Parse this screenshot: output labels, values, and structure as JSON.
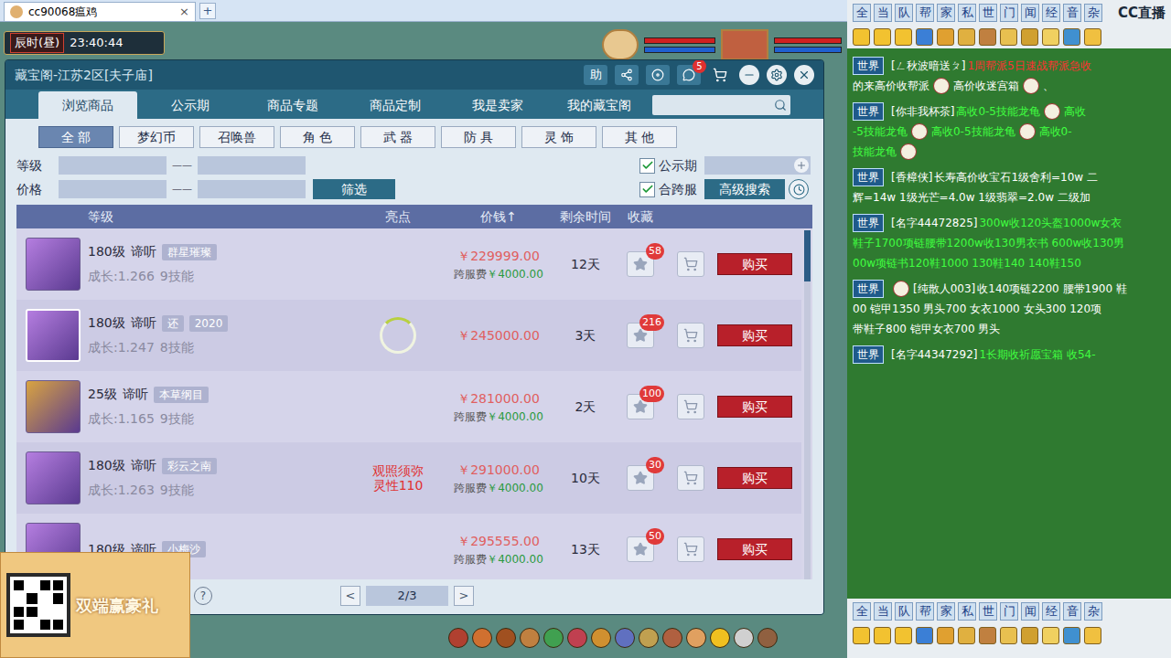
{
  "browser_tab": {
    "title": "cc90068瘟鸡",
    "close": "×",
    "new_tab": "+"
  },
  "game_clock": {
    "period": "辰时(昼)",
    "time": "23:40:44"
  },
  "dialog": {
    "title": "藏宝阁-江苏2区[夫子庙]",
    "help": "助",
    "message_badge": "5",
    "tabs": [
      {
        "label": "浏览商品",
        "selected": true
      },
      {
        "label": "公示期",
        "selected": false
      },
      {
        "label": "商品专题",
        "selected": false
      },
      {
        "label": "商品定制",
        "selected": false
      },
      {
        "label": "我是卖家",
        "selected": false
      },
      {
        "label": "我的藏宝阁",
        "selected": false
      }
    ],
    "categories": [
      {
        "label": "全 部",
        "selected": true
      },
      {
        "label": "梦幻币",
        "selected": false
      },
      {
        "label": "召唤兽",
        "selected": false
      },
      {
        "label": "角 色",
        "selected": false
      },
      {
        "label": "武 器",
        "selected": false
      },
      {
        "label": "防 具",
        "selected": false
      },
      {
        "label": "灵 饰",
        "selected": false
      },
      {
        "label": "其 他",
        "selected": false
      }
    ],
    "filters": {
      "level_label": "等级",
      "price_label": "价格",
      "dash": "——",
      "filter_button": "筛选",
      "public_label": "公示期",
      "public_checked": true,
      "cross_label": "合跨服",
      "cross_checked": true,
      "advanced_button": "高级搜索"
    },
    "columns": [
      "等级",
      "亮点",
      "价钱↑",
      "剩余时间",
      "收藏"
    ],
    "rows": [
      {
        "level": "180级",
        "name": "谛听",
        "tags": [
          "群星璀璨"
        ],
        "growth": "成长:1.266",
        "skills": "9技能",
        "highlight": "",
        "price": "￥229999.00",
        "fee_label": "跨服费",
        "fee": "￥4000.00",
        "time": "12天",
        "favorites": "58",
        "buy": "购买",
        "selected": false,
        "loading": false,
        "color": "#b57ee0"
      },
      {
        "level": "180级",
        "name": "谛听",
        "tags": [
          "还",
          "2020"
        ],
        "growth": "成长:1.247",
        "skills": "8技能",
        "highlight": "",
        "price": "￥245000.00",
        "fee_label": "",
        "fee": "",
        "time": "3天",
        "favorites": "216",
        "buy": "购买",
        "selected": true,
        "loading": true,
        "color": "#b57ee0"
      },
      {
        "level": "25级",
        "name": "谛听",
        "tags": [
          "本草纲目"
        ],
        "growth": "成长:1.165",
        "skills": "9技能",
        "highlight": "",
        "price": "￥281000.00",
        "fee_label": "跨服费",
        "fee": "￥4000.00",
        "time": "2天",
        "favorites": "100",
        "buy": "购买",
        "selected": false,
        "loading": false,
        "color": "#d9a441"
      },
      {
        "level": "180级",
        "name": "谛听",
        "tags": [
          "彩云之南"
        ],
        "growth": "成长:1.263",
        "skills": "9技能",
        "highlight": "观照须弥\n灵性110",
        "price": "￥291000.00",
        "fee_label": "跨服费",
        "fee": "￥4000.00",
        "time": "10天",
        "favorites": "30",
        "buy": "购买",
        "selected": false,
        "loading": false,
        "color": "#b57ee0"
      },
      {
        "level": "180级",
        "name": "谛听",
        "tags": [
          "小梅沙"
        ],
        "growth": "",
        "skills": "",
        "highlight": "",
        "price": "￥295555.00",
        "fee_label": "跨服费",
        "fee": "￥4000.00",
        "time": "13天",
        "favorites": "50",
        "buy": "购买",
        "selected": false,
        "loading": false,
        "color": "#b57ee0"
      }
    ],
    "pagination": {
      "help": "?",
      "prev": "<",
      "page": "2/3",
      "next": ">"
    }
  },
  "promo": {
    "text": "双端赢豪礼"
  },
  "chat": {
    "channels": [
      "全",
      "当",
      "队",
      "帮",
      "家",
      "私",
      "世",
      "门",
      "闻",
      "经",
      "音",
      "杂"
    ],
    "logo": "CC直播",
    "messages": [
      {
        "channel": "世界",
        "lines": [
          [
            {
              "text": "[ㄥ秋波暗送ㄆ]",
              "color": "#ffffff"
            },
            {
              "text": "1周帮派5日速战帮派急收",
              "color": "#ff3030"
            }
          ],
          [
            {
              "text": "的来高价收帮派",
              "color": "#ffffff"
            },
            {
              "kind": "emoji"
            },
            {
              "text": "高价收迷宫箱",
              "color": "#ffffff"
            },
            {
              "kind": "emoji"
            },
            {
              "text": "、",
              "color": "#ffffff"
            }
          ]
        ]
      },
      {
        "channel": "世界",
        "lines": [
          [
            {
              "text": "[你非我杯茶]",
              "color": "#ffffff"
            },
            {
              "text": "高收0-5技能龙龟",
              "color": "#40ff40"
            },
            {
              "kind": "emoji"
            },
            {
              "text": "高收",
              "color": "#40ff40"
            }
          ],
          [
            {
              "text": "-5技能龙龟",
              "color": "#40ff40"
            },
            {
              "kind": "emoji"
            },
            {
              "text": "高收0-5技能龙龟",
              "color": "#40ff40"
            },
            {
              "kind": "emoji"
            },
            {
              "text": "高收0-",
              "color": "#40ff40"
            }
          ],
          [
            {
              "text": "技能龙龟",
              "color": "#40ff40"
            },
            {
              "kind": "emoji"
            }
          ]
        ]
      },
      {
        "channel": "世界",
        "lines": [
          [
            {
              "text": "[香樟侠]",
              "color": "#ffffff"
            },
            {
              "text": "长寿高价收宝石1级舍利=10w 二",
              "color": "#ffffff"
            }
          ],
          [
            {
              "text": "辉=14w 1级光芒=4.0w 1级翡翠=2.0w 二级加",
              "color": "#ffffff"
            }
          ]
        ]
      },
      {
        "channel": "世界",
        "lines": [
          [
            {
              "text": "[名字44472825]",
              "color": "#ffffff"
            },
            {
              "text": "300w收120头盔1000w女衣",
              "color": "#40ff40"
            }
          ],
          [
            {
              "text": "鞋子1700项链腰带1200w收130男衣书 600w收130男",
              "color": "#40ff40"
            }
          ],
          [
            {
              "text": "00w项链书120鞋1000 130鞋140 140鞋150",
              "color": "#40ff40"
            }
          ]
        ]
      },
      {
        "channel": "世界",
        "lines": [
          [
            {
              "kind": "emoji"
            },
            {
              "text": "[纯散人003]",
              "color": "#ffffff"
            },
            {
              "text": "收140项链2200 腰带1900 鞋",
              "color": "#ffffff"
            }
          ],
          [
            {
              "text": "00 铠甲1350 男头700 女衣1000 女头300 120项",
              "color": "#ffffff"
            }
          ],
          [
            {
              "text": "带鞋子800 铠甲女衣700 男头",
              "color": "#ffffff"
            }
          ]
        ]
      },
      {
        "channel": "世界",
        "lines": [
          [
            {
              "text": "[名字44347292]",
              "color": "#ffffff"
            },
            {
              "text": "1长期收祈愿宝箱 收54-",
              "color": "#40ff40"
            }
          ]
        ]
      }
    ]
  }
}
